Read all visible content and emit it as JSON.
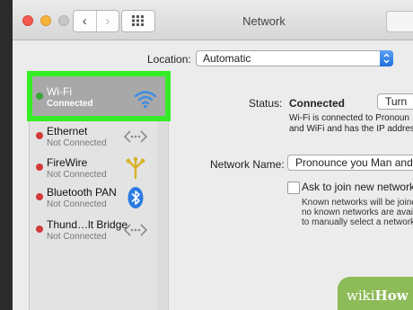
{
  "window": {
    "title": "Network",
    "colors": {
      "close": "#f25a4f",
      "minimize": "#f6b33a",
      "zoom": "#c7c7c7",
      "accent": "#2a7ae2",
      "highlight": "#35ec26"
    }
  },
  "toolbar": {
    "back": "‹",
    "forward": "›"
  },
  "location": {
    "label": "Location:",
    "value": "Automatic"
  },
  "services": [
    {
      "name": "Wi-Fi",
      "status": "Connected",
      "icon": "wifi-icon",
      "selected": true
    },
    {
      "name": "Ethernet",
      "status": "Not Connected",
      "icon": "ethernet-icon"
    },
    {
      "name": "FireWire",
      "status": "Not Connected",
      "icon": "firewire-icon"
    },
    {
      "name": "Bluetooth PAN",
      "status": "Not Connected",
      "icon": "bluetooth-icon"
    },
    {
      "name": "Thund…lt Bridge",
      "status": "Not Connected",
      "icon": "thunderbolt-bridge-icon"
    }
  ],
  "detail": {
    "status_label": "Status:",
    "status_value": "Connected",
    "turn_button": "Turn",
    "status_desc_line1": "Wi-Fi is connected to  Pronoun",
    "status_desc_line2": "and WiFi and has the IP addres",
    "network_name_label": "Network Name:",
    "network_name_value": "Pronounce you Man and",
    "ask_join_label": "Ask to join new network",
    "ask_join_note_line1": "Known networks will be joined",
    "ask_join_note_line2": "no known networks are availab",
    "ask_join_note_line3": "to manually select a network."
  },
  "watermark": {
    "brand_light": "wiki",
    "brand_bold": "How"
  }
}
